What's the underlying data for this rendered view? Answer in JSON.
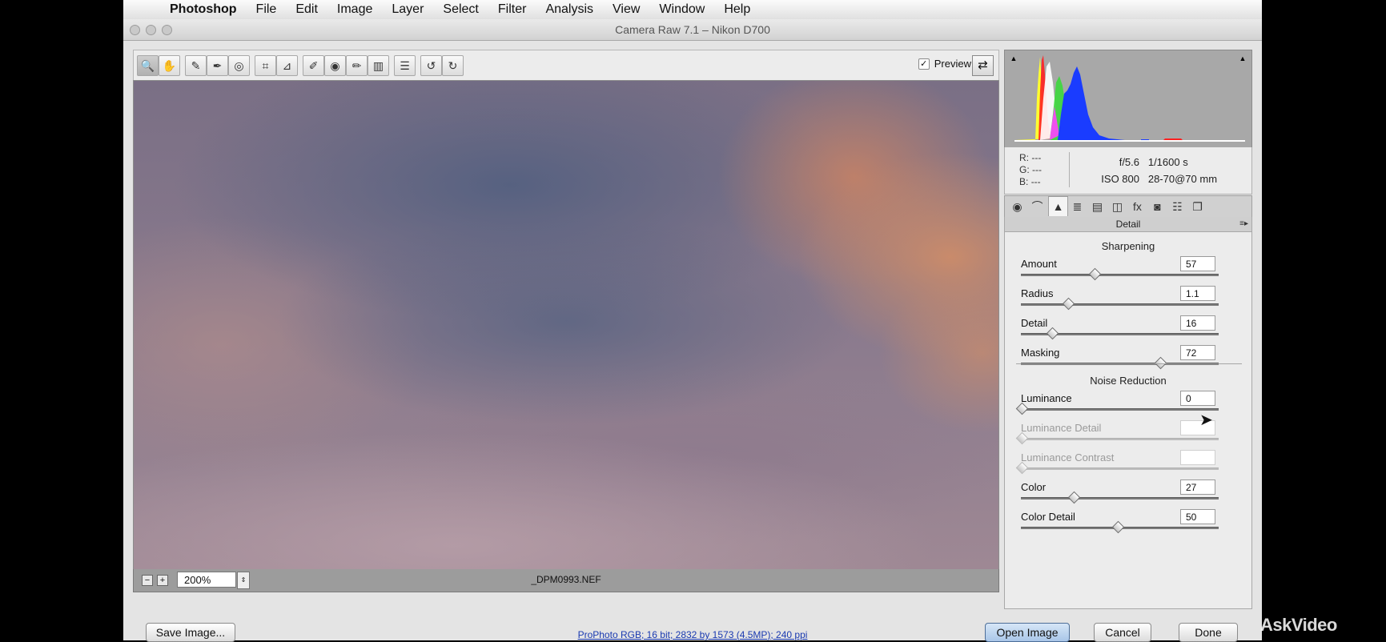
{
  "menubar": {
    "app": "Photoshop",
    "items": [
      "File",
      "Edit",
      "Image",
      "Layer",
      "Select",
      "Filter",
      "Analysis",
      "View",
      "Window",
      "Help"
    ]
  },
  "window": {
    "title": "Camera Raw 7.1  –  Nikon D700"
  },
  "toolbar": {
    "tools": [
      {
        "name": "zoom-tool",
        "glyph": "🔍"
      },
      {
        "name": "hand-tool",
        "glyph": "✋"
      },
      {
        "name": "white-balance-tool",
        "glyph": "✎"
      },
      {
        "name": "color-sampler-tool",
        "glyph": "✒"
      },
      {
        "name": "targeted-adjustment-tool",
        "glyph": "◎"
      },
      {
        "name": "crop-tool",
        "glyph": "⌗"
      },
      {
        "name": "straighten-tool",
        "glyph": "⊿"
      },
      {
        "name": "spot-removal-tool",
        "glyph": "✐"
      },
      {
        "name": "red-eye-tool",
        "glyph": "◉"
      },
      {
        "name": "adjustment-brush-tool",
        "glyph": "✏"
      },
      {
        "name": "graduated-filter-tool",
        "glyph": "▥"
      },
      {
        "name": "preferences-tool",
        "glyph": "☰"
      },
      {
        "name": "rotate-ccw-tool",
        "glyph": "↺"
      },
      {
        "name": "rotate-cw-tool",
        "glyph": "↻"
      }
    ],
    "preview_label": "Preview",
    "preview_checked": "✓",
    "fullscreen_glyph": "⇄"
  },
  "status": {
    "zoom": "200%",
    "filename": "_DPM0993.NEF",
    "zoom_out": "−",
    "zoom_in": "+",
    "zoom_stepper": "⇕"
  },
  "readout": {
    "r_label": "R:",
    "r_value": "---",
    "g_label": "G:",
    "g_value": "---",
    "b_label": "B:",
    "b_value": "---",
    "aperture": "f/5.6",
    "shutter": "1/1600 s",
    "iso": "ISO 800",
    "lens": "28-70@70 mm"
  },
  "histogram": {
    "clip_shadow": "▲",
    "clip_highlight": "▲",
    "colors": {
      "red": "#ff2020",
      "green": "#3cd83c",
      "blue": "#1a3cff",
      "yellow": "#ffff30",
      "magenta": "#ff40ff",
      "cyan": "#40f0ff",
      "white": "#ffffff"
    }
  },
  "panel_tabs": [
    {
      "name": "basic-tab",
      "glyph": "◉"
    },
    {
      "name": "tone-curve-tab",
      "glyph": "⌒"
    },
    {
      "name": "detail-tab",
      "glyph": "▲"
    },
    {
      "name": "hsl-tab",
      "glyph": "≣"
    },
    {
      "name": "split-toning-tab",
      "glyph": "▤"
    },
    {
      "name": "lens-corrections-tab",
      "glyph": "◫"
    },
    {
      "name": "effects-tab",
      "glyph": "fx"
    },
    {
      "name": "camera-calibration-tab",
      "glyph": "◙"
    },
    {
      "name": "presets-tab",
      "glyph": "☷"
    },
    {
      "name": "snapshots-tab",
      "glyph": "❐"
    }
  ],
  "panel": {
    "header": "Detail",
    "menu_glyph": "≡▸",
    "sharpening_title": "Sharpening",
    "noise_title": "Noise Reduction",
    "sharpening": [
      {
        "label": "Amount",
        "value": "57",
        "fraction": 0.38,
        "enabled": true
      },
      {
        "label": "Radius",
        "value": "1.1",
        "fraction": 0.24,
        "enabled": true
      },
      {
        "label": "Detail",
        "value": "16",
        "fraction": 0.16,
        "enabled": true
      },
      {
        "label": "Masking",
        "value": "72",
        "fraction": 0.72,
        "enabled": true
      }
    ],
    "noise": [
      {
        "label": "Luminance",
        "value": "0",
        "fraction": 0.0,
        "enabled": true
      },
      {
        "label": "Luminance Detail",
        "value": "",
        "fraction": 0.0,
        "enabled": false
      },
      {
        "label": "Luminance Contrast",
        "value": "",
        "fraction": 0.0,
        "enabled": false
      },
      {
        "label": "Color",
        "value": "27",
        "fraction": 0.27,
        "enabled": true
      },
      {
        "label": "Color Detail",
        "value": "50",
        "fraction": 0.5,
        "enabled": true
      }
    ]
  },
  "footer": {
    "save": "Save Image...",
    "workflow": "ProPhoto RGB; 16 bit; 2832 by 1573 (4.5MP); 240 ppi",
    "open": "Open Image",
    "cancel": "Cancel",
    "done": "Done"
  },
  "watermark": "AskVideo"
}
